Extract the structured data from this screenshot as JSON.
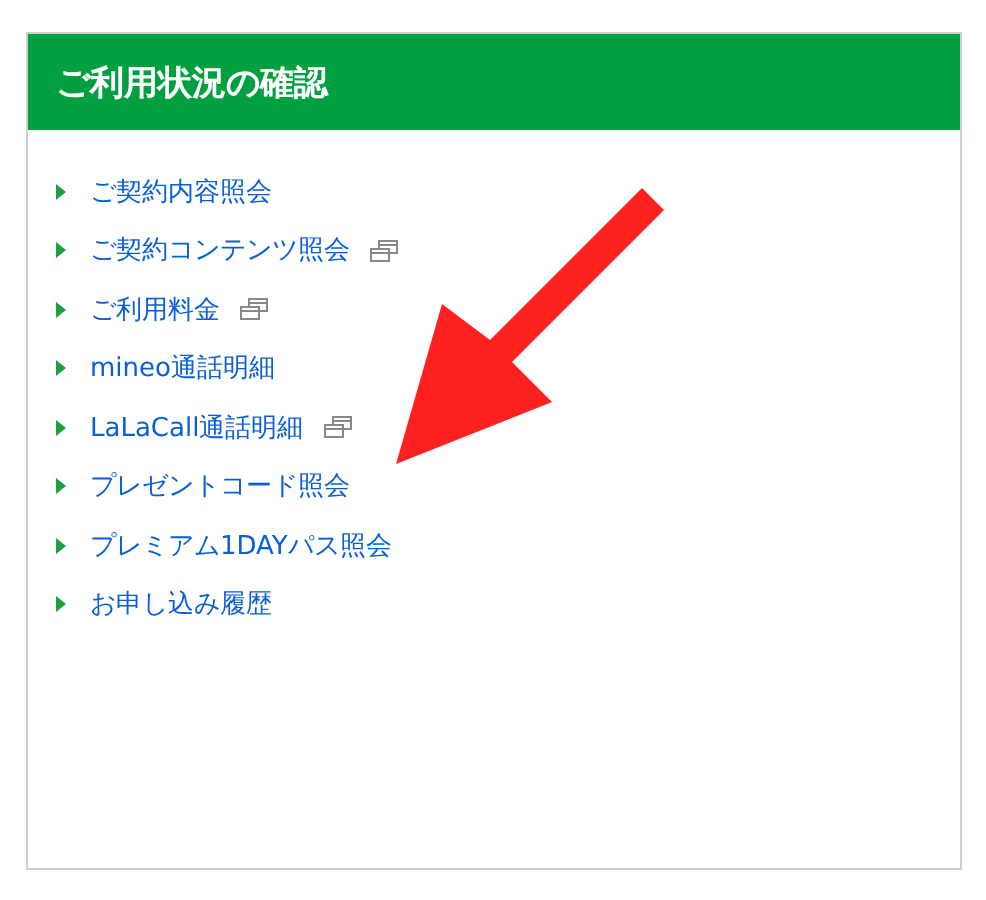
{
  "panel": {
    "title": "ご利用状況の確認"
  },
  "links": [
    {
      "label": "ご契約内容照会",
      "new_window": false
    },
    {
      "label": "ご契約コンテンツ照会",
      "new_window": true
    },
    {
      "label": "ご利用料金",
      "new_window": true
    },
    {
      "label": "mineo通話明細",
      "new_window": false
    },
    {
      "label": "LaLaCall通話明細",
      "new_window": true
    },
    {
      "label": "プレゼントコード照会",
      "new_window": false
    },
    {
      "label": "プレミアム1DAYパス照会",
      "new_window": false
    },
    {
      "label": "お申し込み履歴",
      "new_window": false
    }
  ]
}
